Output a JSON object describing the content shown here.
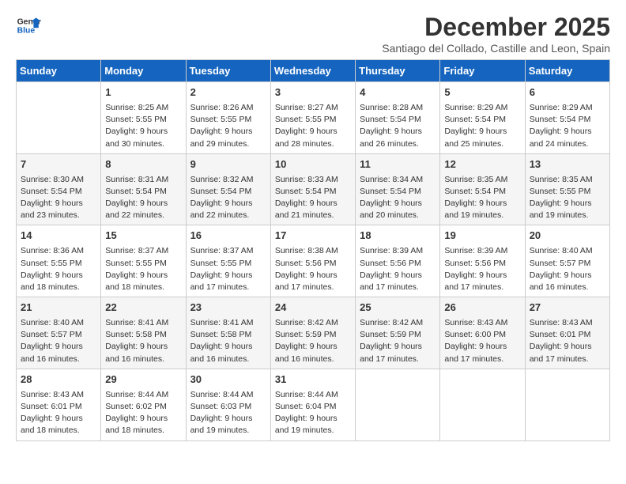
{
  "logo": {
    "line1": "General",
    "line2": "Blue"
  },
  "title": "December 2025",
  "subtitle": "Santiago del Collado, Castille and Leon, Spain",
  "weekdays": [
    "Sunday",
    "Monday",
    "Tuesday",
    "Wednesday",
    "Thursday",
    "Friday",
    "Saturday"
  ],
  "weeks": [
    [
      {
        "day": "",
        "info": ""
      },
      {
        "day": "1",
        "info": "Sunrise: 8:25 AM\nSunset: 5:55 PM\nDaylight: 9 hours\nand 30 minutes."
      },
      {
        "day": "2",
        "info": "Sunrise: 8:26 AM\nSunset: 5:55 PM\nDaylight: 9 hours\nand 29 minutes."
      },
      {
        "day": "3",
        "info": "Sunrise: 8:27 AM\nSunset: 5:55 PM\nDaylight: 9 hours\nand 28 minutes."
      },
      {
        "day": "4",
        "info": "Sunrise: 8:28 AM\nSunset: 5:54 PM\nDaylight: 9 hours\nand 26 minutes."
      },
      {
        "day": "5",
        "info": "Sunrise: 8:29 AM\nSunset: 5:54 PM\nDaylight: 9 hours\nand 25 minutes."
      },
      {
        "day": "6",
        "info": "Sunrise: 8:29 AM\nSunset: 5:54 PM\nDaylight: 9 hours\nand 24 minutes."
      }
    ],
    [
      {
        "day": "7",
        "info": "Sunrise: 8:30 AM\nSunset: 5:54 PM\nDaylight: 9 hours\nand 23 minutes."
      },
      {
        "day": "8",
        "info": "Sunrise: 8:31 AM\nSunset: 5:54 PM\nDaylight: 9 hours\nand 22 minutes."
      },
      {
        "day": "9",
        "info": "Sunrise: 8:32 AM\nSunset: 5:54 PM\nDaylight: 9 hours\nand 22 minutes."
      },
      {
        "day": "10",
        "info": "Sunrise: 8:33 AM\nSunset: 5:54 PM\nDaylight: 9 hours\nand 21 minutes."
      },
      {
        "day": "11",
        "info": "Sunrise: 8:34 AM\nSunset: 5:54 PM\nDaylight: 9 hours\nand 20 minutes."
      },
      {
        "day": "12",
        "info": "Sunrise: 8:35 AM\nSunset: 5:54 PM\nDaylight: 9 hours\nand 19 minutes."
      },
      {
        "day": "13",
        "info": "Sunrise: 8:35 AM\nSunset: 5:55 PM\nDaylight: 9 hours\nand 19 minutes."
      }
    ],
    [
      {
        "day": "14",
        "info": "Sunrise: 8:36 AM\nSunset: 5:55 PM\nDaylight: 9 hours\nand 18 minutes."
      },
      {
        "day": "15",
        "info": "Sunrise: 8:37 AM\nSunset: 5:55 PM\nDaylight: 9 hours\nand 18 minutes."
      },
      {
        "day": "16",
        "info": "Sunrise: 8:37 AM\nSunset: 5:55 PM\nDaylight: 9 hours\nand 17 minutes."
      },
      {
        "day": "17",
        "info": "Sunrise: 8:38 AM\nSunset: 5:56 PM\nDaylight: 9 hours\nand 17 minutes."
      },
      {
        "day": "18",
        "info": "Sunrise: 8:39 AM\nSunset: 5:56 PM\nDaylight: 9 hours\nand 17 minutes."
      },
      {
        "day": "19",
        "info": "Sunrise: 8:39 AM\nSunset: 5:56 PM\nDaylight: 9 hours\nand 17 minutes."
      },
      {
        "day": "20",
        "info": "Sunrise: 8:40 AM\nSunset: 5:57 PM\nDaylight: 9 hours\nand 16 minutes."
      }
    ],
    [
      {
        "day": "21",
        "info": "Sunrise: 8:40 AM\nSunset: 5:57 PM\nDaylight: 9 hours\nand 16 minutes."
      },
      {
        "day": "22",
        "info": "Sunrise: 8:41 AM\nSunset: 5:58 PM\nDaylight: 9 hours\nand 16 minutes."
      },
      {
        "day": "23",
        "info": "Sunrise: 8:41 AM\nSunset: 5:58 PM\nDaylight: 9 hours\nand 16 minutes."
      },
      {
        "day": "24",
        "info": "Sunrise: 8:42 AM\nSunset: 5:59 PM\nDaylight: 9 hours\nand 16 minutes."
      },
      {
        "day": "25",
        "info": "Sunrise: 8:42 AM\nSunset: 5:59 PM\nDaylight: 9 hours\nand 17 minutes."
      },
      {
        "day": "26",
        "info": "Sunrise: 8:43 AM\nSunset: 6:00 PM\nDaylight: 9 hours\nand 17 minutes."
      },
      {
        "day": "27",
        "info": "Sunrise: 8:43 AM\nSunset: 6:01 PM\nDaylight: 9 hours\nand 17 minutes."
      }
    ],
    [
      {
        "day": "28",
        "info": "Sunrise: 8:43 AM\nSunset: 6:01 PM\nDaylight: 9 hours\nand 18 minutes."
      },
      {
        "day": "29",
        "info": "Sunrise: 8:44 AM\nSunset: 6:02 PM\nDaylight: 9 hours\nand 18 minutes."
      },
      {
        "day": "30",
        "info": "Sunrise: 8:44 AM\nSunset: 6:03 PM\nDaylight: 9 hours\nand 19 minutes."
      },
      {
        "day": "31",
        "info": "Sunrise: 8:44 AM\nSunset: 6:04 PM\nDaylight: 9 hours\nand 19 minutes."
      },
      {
        "day": "",
        "info": ""
      },
      {
        "day": "",
        "info": ""
      },
      {
        "day": "",
        "info": ""
      }
    ]
  ]
}
